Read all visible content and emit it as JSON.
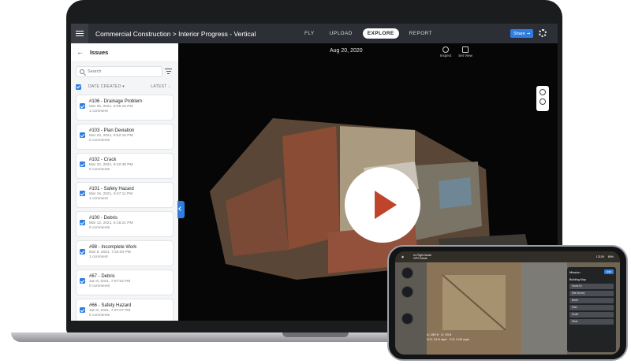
{
  "app": {
    "project_title": "Commercial Construction > Interior Progress - Vertical",
    "nav_tabs": [
      {
        "label": "FLY",
        "active": false
      },
      {
        "label": "UPLOAD",
        "active": false
      },
      {
        "label": "EXPLORE",
        "active": true
      },
      {
        "label": "REPORT",
        "active": false
      }
    ],
    "share_label": "Share"
  },
  "sidebar": {
    "title": "Issues",
    "search_placeholder": "Search",
    "sort_label": "DATE CREATED",
    "order_label": "LATEST",
    "issues": [
      {
        "title": "#106 - Drainage Problem",
        "date": "Mar 26, 2021, 8:55:18 PM",
        "comments": "1 comment"
      },
      {
        "title": "#103 - Plan Deviation",
        "date": "Mar 23, 2021, 9:52:16 PM",
        "comments": "0 comments"
      },
      {
        "title": "#102 - Crack",
        "date": "Mar 22, 2021, 9:42:38 PM",
        "comments": "0 comments"
      },
      {
        "title": "#101 - Safety Hazard",
        "date": "Mar 16, 2021, 9:47:11 PM",
        "comments": "1 comment"
      },
      {
        "title": "#100 - Debris",
        "date": "Mar 12, 2021, 6:15:21 PM",
        "comments": "0 comments"
      },
      {
        "title": "#98 - Incomplete Work",
        "date": "Mar 8, 2021, 7:24:04 PM",
        "comments": "1 comment"
      },
      {
        "title": "#67 - Debris",
        "date": "Jan 6, 2021, 7:07:54 PM",
        "comments": "0 comments"
      },
      {
        "title": "#66 - Safety Hazard",
        "date": "Jan 6, 2021, 7:07:07 PM",
        "comments": "0 comments"
      }
    ]
  },
  "viewer": {
    "date": "Aug 20, 2020",
    "inspect_label": "Inspect",
    "set_view_label": "Set View"
  },
  "phone": {
    "status_title": "In-Flight Mode",
    "status_mode": "GPS Mode",
    "status_battery": "12109",
    "status_percent": "66%",
    "mission_title": "Mission",
    "mission_add": "Add",
    "mission_name": "Building Map",
    "mission_items": [
      "Home 01",
      "Site Survey",
      "North",
      "East",
      "South",
      "West"
    ],
    "telemetry": {
      "alt": "A: 150 ft",
      "dist": "D: 93 ft",
      "hs": "H.S: 12.6 mph",
      "vs": "V.S: 0.00 mph"
    }
  },
  "colors": {
    "accent": "#2f7de1",
    "topbar": "#2c2f35",
    "play_icon": "#c0442c"
  }
}
